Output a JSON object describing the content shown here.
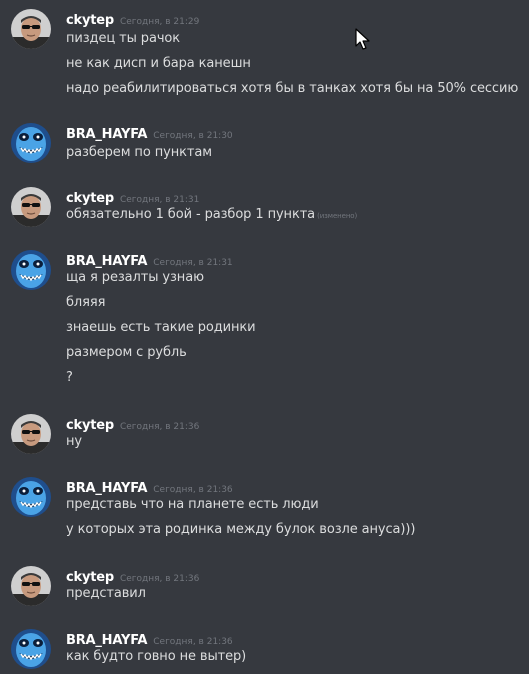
{
  "messages": [
    {
      "author": "ckytep",
      "avatar": "man-sunglasses-avatar",
      "timestamp": "Сегодня, в 21:29",
      "lines": [
        {
          "text": "пиздец ты рачок"
        },
        {
          "text": "не как дисп и бара канешн"
        },
        {
          "text": "надо реабилитироваться хотя бы в танках хотя бы на 50% сессию"
        }
      ]
    },
    {
      "author": "BRA_HAYFA",
      "avatar": "blue-creature-avatar",
      "timestamp": "Сегодня, в 21:30",
      "lines": [
        {
          "text": "разберем по пунктам"
        }
      ]
    },
    {
      "author": "ckytep",
      "avatar": "man-sunglasses-avatar",
      "timestamp": "Сегодня, в 21:31",
      "lines": [
        {
          "text": "обязательно 1 бой - разбор 1 пункта",
          "edited": "(изменено)"
        }
      ]
    },
    {
      "author": "BRA_HAYFA",
      "avatar": "blue-creature-avatar",
      "timestamp": "Сегодня, в 21:31",
      "lines": [
        {
          "text": "ща я резалты узнаю"
        },
        {
          "text": "бляяя"
        },
        {
          "text": "знаешь есть такие родинки"
        },
        {
          "text": "размером с рубль"
        },
        {
          "text": "?"
        }
      ]
    },
    {
      "author": "ckytep",
      "avatar": "man-sunglasses-avatar",
      "timestamp": "Сегодня, в 21:36",
      "lines": [
        {
          "text": "ну"
        }
      ]
    },
    {
      "author": "BRA_HAYFA",
      "avatar": "blue-creature-avatar",
      "timestamp": "Сегодня, в 21:36",
      "lines": [
        {
          "text": "представь что на планете есть люди"
        },
        {
          "text": "у которых эта родинка между булок возле ануса)))"
        }
      ]
    },
    {
      "author": "ckytep",
      "avatar": "man-sunglasses-avatar",
      "timestamp": "Сегодня, в 21:36",
      "lines": [
        {
          "text": "представил"
        }
      ]
    },
    {
      "author": "BRA_HAYFA",
      "avatar": "blue-creature-avatar",
      "timestamp": "Сегодня, в 21:36",
      "lines": [
        {
          "text": "как будто говно не вытер)"
        }
      ]
    }
  ],
  "colors": {
    "background": "#36393f",
    "username": "#ffffff",
    "text": "#dcddde",
    "timestamp": "#72767d"
  },
  "cursor": "mouse-pointer-icon"
}
